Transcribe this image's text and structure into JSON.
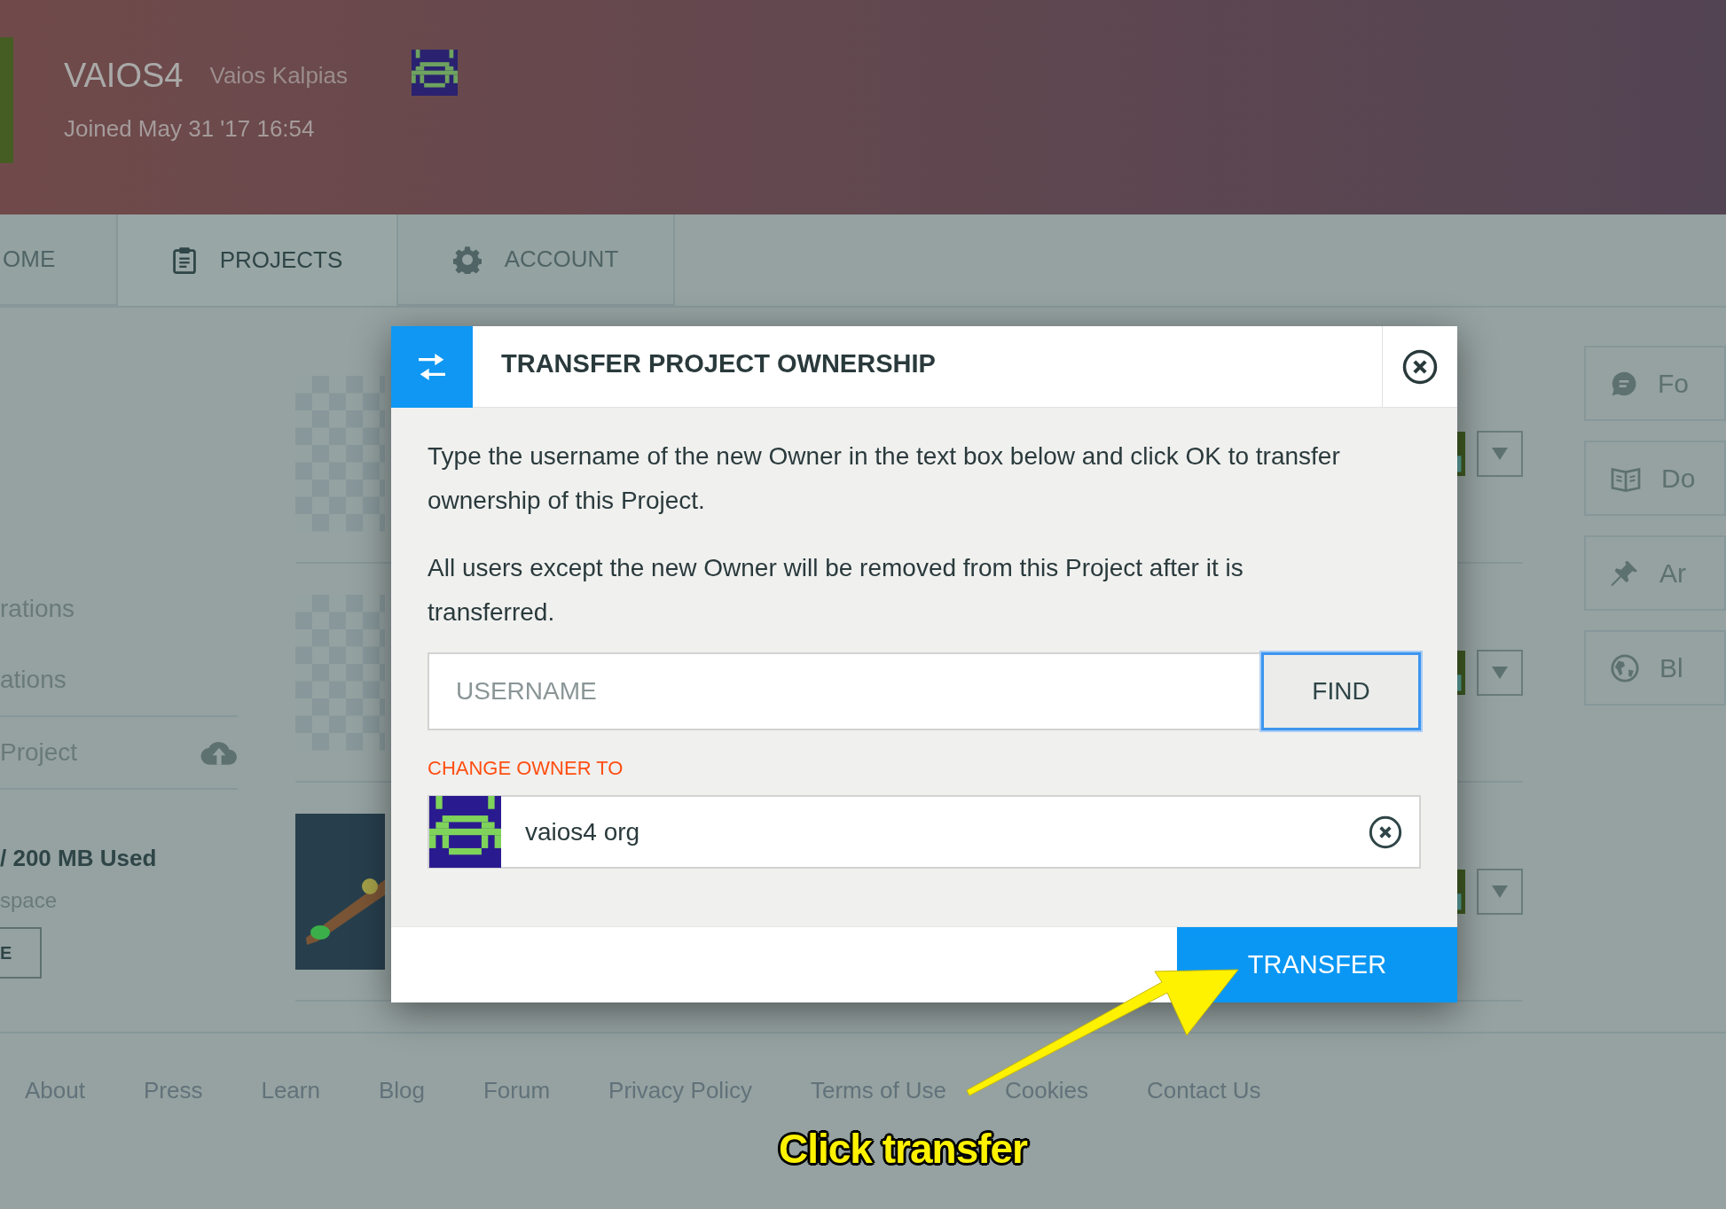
{
  "profile": {
    "username": "VAIOS4",
    "full_name": "Vaios Kalpias",
    "joined": "Joined May 31 '17 16:54"
  },
  "nav_tabs": [
    {
      "label": "OME",
      "selected": false
    },
    {
      "label": "PROJECTS",
      "selected": true
    },
    {
      "label": "ACCOUNT",
      "selected": false
    }
  ],
  "sidebar": {
    "items": [
      {
        "label": "rations"
      },
      {
        "label": "ations"
      },
      {
        "label": "Project"
      }
    ],
    "storage": "/ 200 MB Used",
    "storage_note": "space",
    "button": "E"
  },
  "projects": [
    {
      "kind": "empty"
    },
    {
      "kind": "empty"
    },
    {
      "kind": "model"
    }
  ],
  "right_links": [
    {
      "label": "Fo"
    },
    {
      "label": "Do"
    },
    {
      "label": "Ar"
    },
    {
      "label": "Bl"
    }
  ],
  "modal": {
    "title": "TRANSFER PROJECT OWNERSHIP",
    "paragraphs": [
      "Type the username of the new Owner in the text box below and click OK to transfer ownership of this Project.",
      "All users except the new Owner will be removed from this Project after it is transferred."
    ],
    "username_placeholder": "USERNAME",
    "find_button": {
      "label": "FIND",
      "focused": true
    },
    "section_label": "CHANGE OWNER TO",
    "selected_owner": "vaios4 org",
    "transfer_button": "TRANSFER"
  },
  "footer_links": [
    "About",
    "Press",
    "Learn",
    "Blog",
    "Forum",
    "Privacy Policy",
    "Terms of Use",
    "Cookies",
    "Contact Us"
  ],
  "annotation": {
    "caption": "Click transfer"
  }
}
